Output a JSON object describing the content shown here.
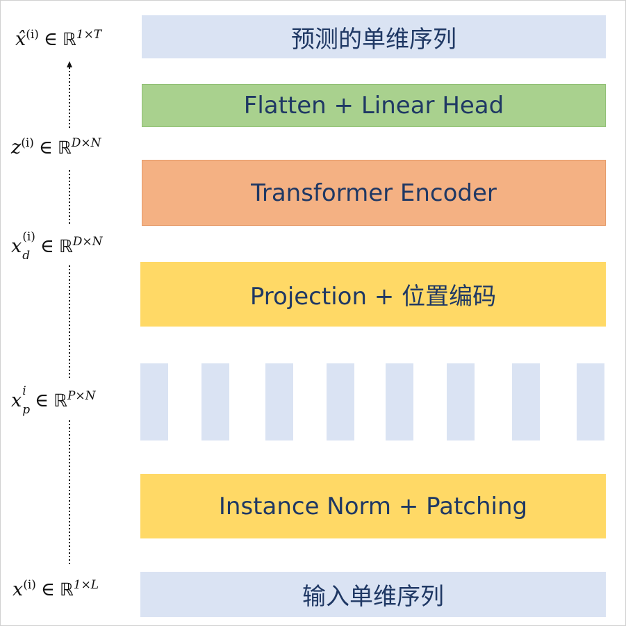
{
  "blocks": {
    "output": "预测的单维序列",
    "head": "Flatten + Linear Head",
    "encoder": "Transformer Encoder",
    "projection": "Projection + 位置编码",
    "norm": "Instance Norm + Patching",
    "input": "输入单维序列"
  },
  "labels": {
    "xhat": {
      "var": "x̂",
      "sup": "(i)",
      "rel": "∈",
      "set": "ℝ",
      "dim": "1×T"
    },
    "z": {
      "var": "z",
      "sup": "(i)",
      "rel": "∈",
      "set": "ℝ",
      "dim": "D×N"
    },
    "xd": {
      "var": "x",
      "sup": "(i)",
      "sub": "d",
      "rel": "∈",
      "set": "ℝ",
      "dim": "D×N"
    },
    "xp": {
      "var": "x",
      "sup": "i",
      "sub": "p",
      "rel": "∈",
      "set": "ℝ",
      "dim": "P×N"
    },
    "x": {
      "var": "x",
      "sup": "(i)",
      "rel": "∈",
      "set": "ℝ",
      "dim": "1×L"
    }
  },
  "colors": {
    "blue": "#dae3f3",
    "green": "#a9d18e",
    "orange": "#f4b183",
    "yellow": "#ffd966",
    "text": "#1f3864"
  },
  "patch_count": 8
}
